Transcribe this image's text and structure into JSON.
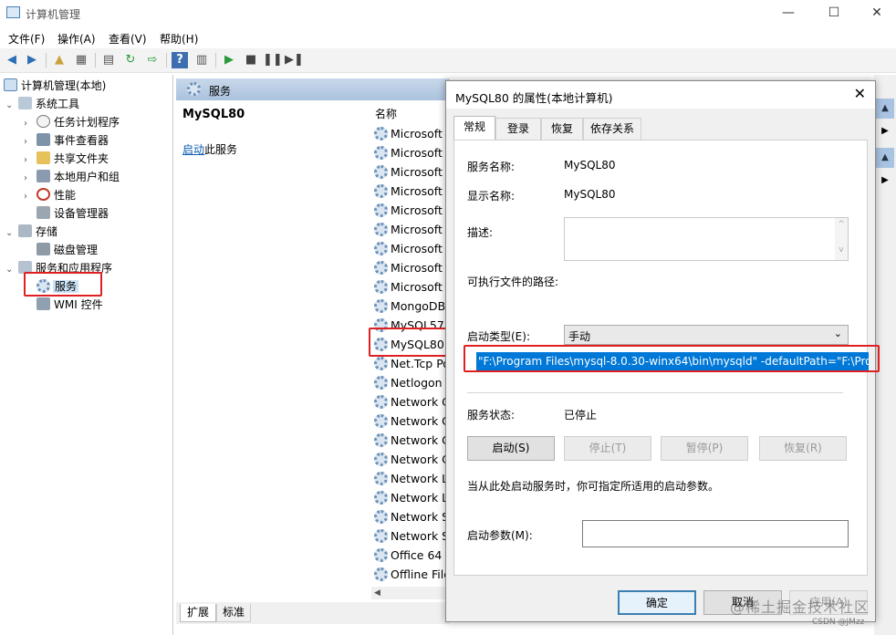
{
  "window": {
    "title": "计算机管理"
  },
  "menu": [
    "文件(F)",
    "操作(A)",
    "查看(V)",
    "帮助(H)"
  ],
  "tree": {
    "root": "计算机管理(本地)",
    "system_tools": "系统工具",
    "task_scheduler": "任务计划程序",
    "event_viewer": "事件查看器",
    "shared_folders": "共享文件夹",
    "local_users": "本地用户和组",
    "performance": "性能",
    "device_manager": "设备管理器",
    "storage": "存储",
    "disk_management": "磁盘管理",
    "services_apps": "服务和应用程序",
    "services": "服务",
    "wmi": "WMI 控件"
  },
  "services_pane": {
    "header": "服务",
    "selected_name": "MySQL80",
    "start_link": "启动",
    "start_link_suffix": "此服务",
    "column_name": "名称",
    "rows": [
      "Microsoft",
      "Microsoft",
      "Microsoft",
      "Microsoft",
      "Microsoft",
      "Microsoft",
      "Microsoft",
      "Microsoft",
      "Microsoft",
      "MongoDB",
      "MySQL57",
      "MySQL80",
      "Net.Tcp Po",
      "Netlogon",
      "Network C",
      "Network C",
      "Network C",
      "Network C",
      "Network L",
      "Network L",
      "Network S",
      "Network S",
      "Office 64 S",
      "Offline File"
    ],
    "tabs": [
      "扩展",
      "标准"
    ]
  },
  "dialog": {
    "title": "MySQL80 的属性(本地计算机)",
    "tabs": [
      "常规",
      "登录",
      "恢复",
      "依存关系"
    ],
    "service_name_label": "服务名称:",
    "service_name": "MySQL80",
    "display_name_label": "显示名称:",
    "display_name": "MySQL80",
    "description_label": "描述:",
    "path_label": "可执行文件的路径:",
    "path_value": "\"F:\\Program Files\\mysql-8.0.30-winx64\\bin\\mysqld\" -defaultPath=\"F:\\Pro",
    "startup_type_label": "启动类型(E):",
    "startup_type": "手动",
    "status_label": "服务状态:",
    "status_value": "已停止",
    "btn_start": "启动(S)",
    "btn_stop": "停止(T)",
    "btn_pause": "暂停(P)",
    "btn_resume": "恢复(R)",
    "hint": "当从此处启动服务时，你可指定所适用的启动参数。",
    "params_label": "启动参数(M):",
    "params_value": "",
    "ok": "确定",
    "cancel": "取消",
    "apply": "应用(A)"
  },
  "watermark": "@稀土掘金技术社区",
  "watermark_small": "CSDN @JMzz"
}
